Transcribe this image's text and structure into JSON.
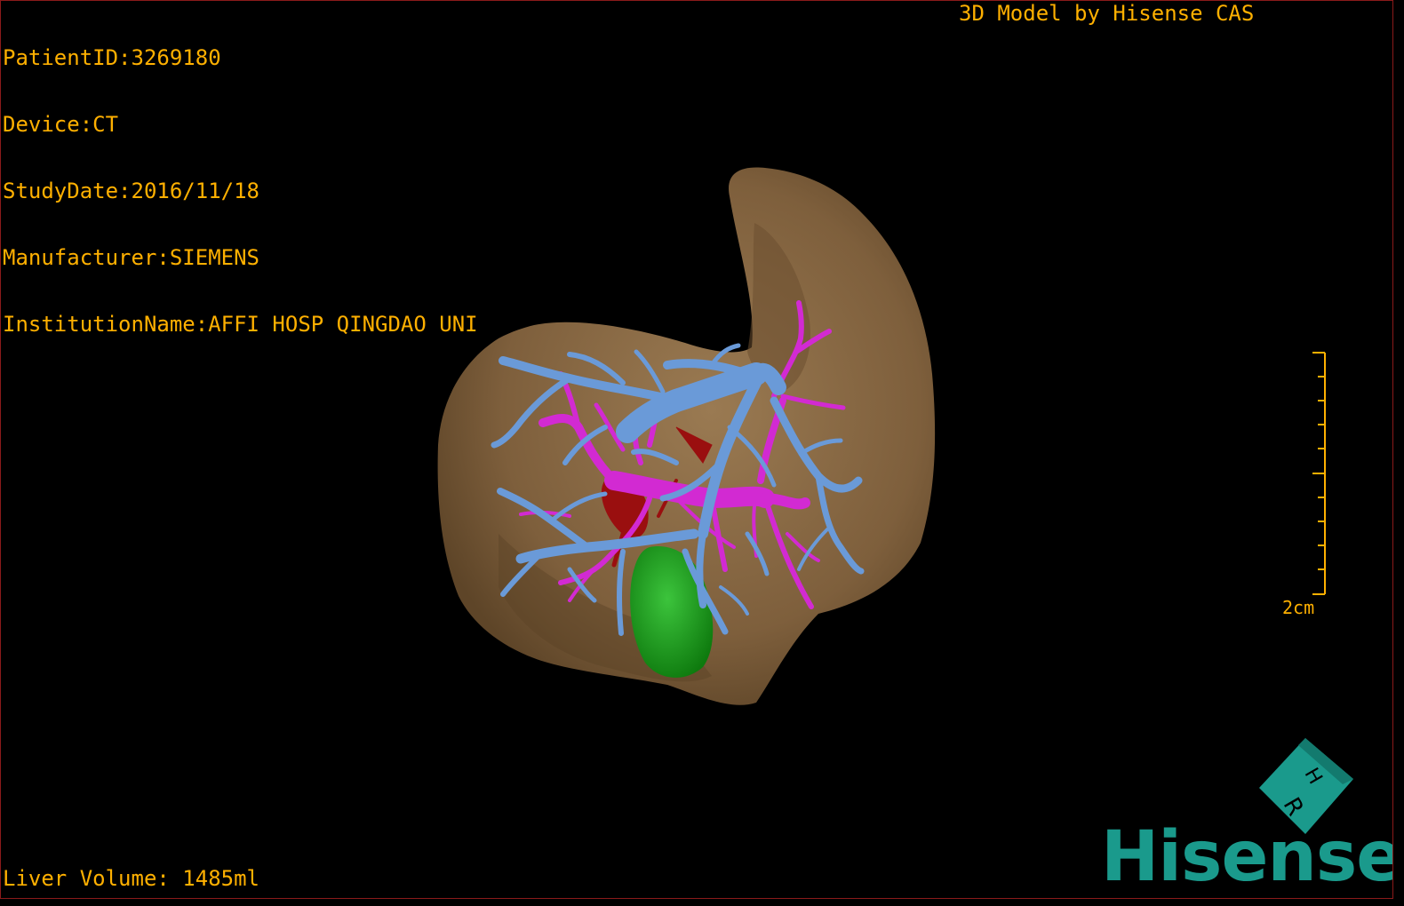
{
  "overlay": {
    "patient_id": "PatientID:3269180",
    "device": "Device:CT",
    "study_date": "StudyDate:2016/11/18",
    "manufacturer": "Manufacturer:SIEMENS",
    "institution": "InstitutionName:AFFI HOSP QINGDAO UNI",
    "model_title": "3D Model by Hisense CAS",
    "liver_volume": "Liver Volume: 1485ml"
  },
  "scale_bar": {
    "label": "2cm"
  },
  "orientation_cube": {
    "letters": [
      "H",
      "R"
    ]
  },
  "brand": {
    "name": "Hisense"
  },
  "colors": {
    "text": "#ffb000",
    "liver": "#8a6a45",
    "hepatic_vein": "#6a9ad8",
    "portal_vein": "#d22ad2",
    "artery": "#9a0f0f",
    "gallbladder": "#1aa01a",
    "brand": "#1a9a8c"
  }
}
